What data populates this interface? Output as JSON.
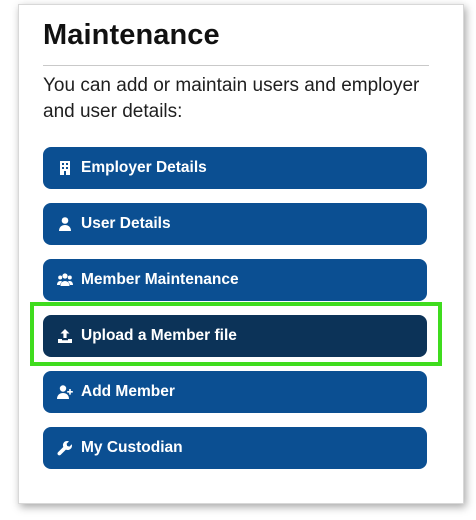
{
  "panel": {
    "title": "Maintenance",
    "intro": "You can add or maintain users and employer and user details:"
  },
  "menu": {
    "items": [
      {
        "label": "Employer Details",
        "icon": "building-icon"
      },
      {
        "label": "User Details",
        "icon": "user-icon"
      },
      {
        "label": "Member Maintenance",
        "icon": "users-icon"
      },
      {
        "label": "Upload a Member file",
        "icon": "upload-icon",
        "selected": true
      },
      {
        "label": "Add Member",
        "icon": "user-plus-icon"
      },
      {
        "label": "My Custodian",
        "icon": "wrench-icon"
      }
    ]
  },
  "colors": {
    "button": "#0b4f92",
    "button_active": "#0c3358",
    "highlight": "#3fdc1e"
  }
}
